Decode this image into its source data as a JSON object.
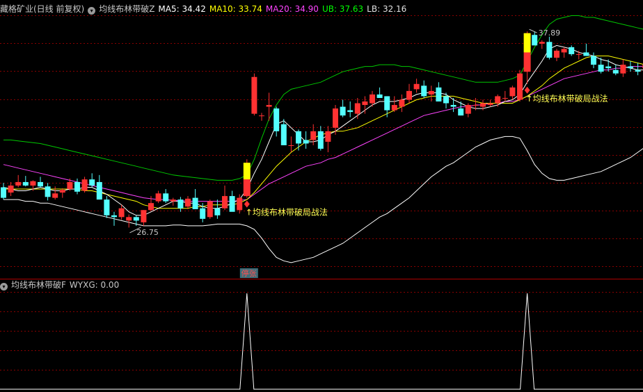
{
  "header": {
    "title": "藏格矿业(日线 前复权)",
    "indicator_name": "均线布林带破Z",
    "ma5": "MA5: 34.42",
    "ma10": "MA10: 33.74",
    "ma20": "MA20: 34.90",
    "ub": "UB: 37.63",
    "lb": "LB: 32.16"
  },
  "sub_header": {
    "indicator_name": "均线布林带破F",
    "value": "WYXG: 0.00"
  },
  "colors": {
    "up": "#ff3232",
    "down": "#54ffff",
    "ma5": "#ffffff",
    "ma10": "#ffff00",
    "ma20": "#ff44ff",
    "ub": "#00c800",
    "lb": "#ffffff",
    "grid": "#8b0000",
    "signal_yellow": "#ffff00",
    "label_yellow": "#ffff54",
    "badge_bg": "#3c6e7a"
  },
  "chart_data": {
    "type": "candlestick",
    "ylim": [
      24.5,
      39.5
    ],
    "annotations": {
      "low_label": "26.75",
      "high_label": "37.89",
      "signal_label": "均线布林带破局战法",
      "badge": "停张"
    },
    "candles": [
      [
        29.6,
        29.85,
        28.9,
        29.0
      ],
      [
        29.3,
        29.9,
        29.1,
        29.7
      ],
      [
        29.7,
        30.3,
        29.6,
        29.9
      ],
      [
        29.9,
        30.25,
        29.65,
        29.7
      ],
      [
        29.7,
        30.0,
        29.4,
        29.95
      ],
      [
        29.9,
        30.2,
        29.6,
        29.65
      ],
      [
        29.65,
        29.85,
        28.85,
        29.05
      ],
      [
        29.0,
        29.65,
        28.9,
        29.25
      ],
      [
        29.3,
        29.55,
        29.0,
        29.45
      ],
      [
        29.5,
        30.1,
        29.4,
        29.9
      ],
      [
        29.9,
        30.1,
        29.2,
        29.35
      ],
      [
        29.4,
        30.2,
        29.3,
        30.05
      ],
      [
        30.05,
        30.4,
        29.6,
        29.7
      ],
      [
        29.9,
        30.3,
        29.0,
        28.9
      ],
      [
        28.9,
        29.1,
        27.85,
        28.0
      ],
      [
        28.0,
        28.2,
        27.4,
        27.9
      ],
      [
        27.9,
        28.6,
        27.75,
        28.4
      ],
      [
        27.7,
        28.05,
        27.3,
        27.9
      ],
      [
        27.9,
        28.0,
        27.4,
        27.7
      ],
      [
        27.6,
        28.3,
        27.4,
        28.3
      ],
      [
        28.3,
        29.1,
        28.25,
        28.7
      ],
      [
        28.8,
        29.4,
        28.7,
        29.25
      ],
      [
        29.25,
        29.5,
        28.7,
        28.8
      ],
      [
        28.8,
        29.0,
        28.55,
        28.9
      ],
      [
        28.9,
        29.05,
        28.2,
        28.4
      ],
      [
        28.5,
        29.1,
        28.35,
        28.95
      ],
      [
        29.0,
        29.5,
        28.9,
        28.35
      ],
      [
        28.4,
        28.7,
        27.6,
        27.8
      ],
      [
        27.9,
        28.9,
        27.8,
        28.8
      ],
      [
        28.4,
        28.9,
        27.8,
        28.0
      ],
      [
        28.4,
        29.7,
        28.3,
        29.1
      ],
      [
        29.1,
        29.4,
        28.4,
        28.2
      ],
      [
        28.3,
        29.2,
        28.1,
        29.0
      ],
      [
        29.1,
        31.2,
        29.0,
        31.0
      ],
      [
        33.8,
        36.1,
        33.7,
        35.9
      ],
      [
        33.7,
        33.85,
        33.4,
        33.7
      ],
      [
        34.2,
        35.0,
        33.4,
        34.3
      ],
      [
        34.1,
        34.2,
        32.5,
        32.8
      ],
      [
        33.2,
        33.5,
        32.0,
        32.0
      ],
      [
        32.0,
        32.5,
        31.6,
        32.0
      ],
      [
        32.8,
        32.9,
        31.7,
        32.1
      ],
      [
        32.3,
        32.8,
        31.8,
        32.1
      ],
      [
        32.3,
        33.2,
        32.0,
        32.8
      ],
      [
        32.8,
        33.1,
        31.7,
        31.8
      ],
      [
        32.2,
        33.1,
        31.6,
        32.8
      ],
      [
        33.0,
        34.3,
        32.6,
        34.1
      ],
      [
        34.2,
        34.6,
        33.6,
        33.7
      ],
      [
        34.0,
        34.5,
        33.6,
        33.9
      ],
      [
        33.8,
        34.7,
        33.5,
        34.4
      ],
      [
        34.3,
        34.8,
        33.8,
        34.5
      ],
      [
        34.4,
        35.1,
        34.2,
        34.9
      ],
      [
        34.9,
        35.3,
        34.7,
        34.7
      ],
      [
        34.8,
        34.8,
        33.6,
        34.0
      ],
      [
        34.0,
        34.8,
        33.9,
        34.3
      ],
      [
        34.2,
        34.9,
        33.9,
        34.6
      ],
      [
        34.6,
        35.5,
        34.4,
        35.1
      ],
      [
        35.2,
        35.8,
        35.0,
        35.5
      ],
      [
        35.4,
        35.7,
        34.7,
        34.8
      ],
      [
        34.9,
        35.4,
        34.5,
        35.1
      ],
      [
        35.3,
        35.6,
        34.5,
        34.5
      ],
      [
        34.8,
        35.0,
        34.1,
        34.4
      ],
      [
        34.3,
        34.7,
        33.9,
        34.2
      ],
      [
        34.1,
        34.5,
        33.7,
        33.7
      ],
      [
        33.8,
        34.4,
        33.6,
        34.3
      ],
      [
        34.3,
        34.7,
        34.0,
        34.3
      ],
      [
        34.2,
        34.6,
        34.0,
        34.4
      ],
      [
        34.3,
        34.6,
        34.2,
        34.4
      ],
      [
        34.4,
        34.9,
        34.2,
        34.8
      ],
      [
        34.7,
        35.1,
        34.5,
        34.7
      ],
      [
        34.8,
        35.4,
        34.6,
        35.3
      ],
      [
        34.6,
        36.3,
        34.5,
        36.1
      ],
      [
        36.2,
        38.5,
        35.5,
        38.4
      ],
      [
        38.3,
        38.5,
        37.7,
        37.7
      ],
      [
        37.8,
        38.0,
        37.5,
        37.9
      ],
      [
        37.9,
        38.2,
        36.9,
        37.0
      ],
      [
        37.0,
        37.5,
        36.8,
        37.4
      ],
      [
        37.3,
        37.6,
        37.0,
        37.5
      ],
      [
        37.6,
        37.7,
        37.1,
        37.2
      ],
      [
        37.2,
        37.4,
        36.9,
        37.2
      ],
      [
        37.3,
        37.8,
        37.1,
        37.1
      ],
      [
        37.1,
        37.3,
        36.4,
        36.6
      ],
      [
        36.6,
        37.0,
        36.1,
        36.2
      ],
      [
        36.5,
        36.9,
        36.2,
        36.4
      ],
      [
        36.3,
        36.6,
        36.0,
        36.1
      ],
      [
        36.1,
        36.9,
        35.9,
        36.6
      ],
      [
        36.5,
        36.8,
        36.2,
        36.4
      ],
      [
        36.3,
        36.7,
        36.0,
        36.2
      ],
      [
        36.4,
        36.8,
        36.2,
        36.6
      ],
      [
        36.6,
        37.5,
        36.2,
        37.2
      ],
      [
        37.2,
        38.2,
        36.7,
        36.7
      ],
      [
        36.8,
        37.4,
        36.5,
        37.3
      ]
    ],
    "ma5": [
      29.6,
      29.5,
      29.4,
      29.4,
      29.5,
      29.6,
      29.5,
      29.4,
      29.4,
      29.5,
      29.5,
      29.6,
      29.6,
      29.4,
      29.2,
      28.9,
      28.6,
      28.2,
      28.0,
      28.0,
      28.2,
      28.4,
      28.6,
      28.8,
      28.8,
      28.7,
      28.7,
      28.5,
      28.4,
      28.4,
      28.5,
      28.7,
      28.9,
      29.5,
      30.4,
      31.2,
      32.2,
      33.2,
      33.4,
      33.0,
      32.6,
      32.2,
      32.2,
      32.3,
      32.6,
      32.8,
      33.1,
      33.4,
      33.7,
      34.0,
      34.3,
      34.5,
      34.5,
      34.5,
      34.6,
      34.7,
      34.9,
      35.0,
      35.0,
      35.0,
      34.9,
      34.6,
      34.4,
      34.2,
      34.1,
      34.1,
      34.2,
      34.3,
      34.5,
      34.6,
      34.9,
      35.6,
      36.2,
      36.8,
      37.5,
      37.7,
      37.6,
      37.5,
      37.3,
      37.2,
      37.1,
      36.9,
      36.8,
      36.6,
      36.5,
      36.4,
      36.3,
      36.3,
      36.4,
      36.6,
      36.7
    ],
    "ma10": [
      29.5,
      29.5,
      29.5,
      29.5,
      29.5,
      29.5,
      29.5,
      29.5,
      29.5,
      29.5,
      29.5,
      29.4,
      29.4,
      29.3,
      29.2,
      29.1,
      29.0,
      28.9,
      28.8,
      28.6,
      28.5,
      28.4,
      28.4,
      28.4,
      28.4,
      28.4,
      28.5,
      28.5,
      28.6,
      28.6,
      28.6,
      28.6,
      28.7,
      28.9,
      29.3,
      29.8,
      30.3,
      30.8,
      31.2,
      31.6,
      31.9,
      32.2,
      32.4,
      32.6,
      32.7,
      32.8,
      32.8,
      32.9,
      33.0,
      33.2,
      33.4,
      33.6,
      33.8,
      34.0,
      34.2,
      34.4,
      34.6,
      34.7,
      34.8,
      34.8,
      34.8,
      34.8,
      34.7,
      34.6,
      34.5,
      34.4,
      34.4,
      34.4,
      34.4,
      34.4,
      34.6,
      34.8,
      35.1,
      35.4,
      35.8,
      36.1,
      36.4,
      36.6,
      36.8,
      37.0,
      37.1,
      37.1,
      37.1,
      37.0,
      36.9,
      36.8,
      36.7,
      36.6,
      36.6,
      36.6,
      36.6
    ],
    "ma20": [
      30.9,
      30.8,
      30.7,
      30.6,
      30.5,
      30.4,
      30.3,
      30.2,
      30.1,
      30.0,
      29.9,
      29.8,
      29.7,
      29.6,
      29.5,
      29.4,
      29.3,
      29.2,
      29.1,
      29.0,
      28.95,
      28.9,
      28.9,
      28.85,
      28.85,
      28.8,
      28.8,
      28.8,
      28.8,
      28.8,
      28.8,
      28.8,
      28.85,
      28.9,
      29.2,
      29.5,
      29.8,
      30.0,
      30.2,
      30.4,
      30.6,
      30.8,
      30.9,
      31.0,
      31.2,
      31.3,
      31.5,
      31.7,
      31.9,
      32.1,
      32.3,
      32.5,
      32.7,
      32.9,
      33.1,
      33.3,
      33.5,
      33.7,
      33.8,
      33.9,
      34.0,
      34.1,
      34.2,
      34.2,
      34.3,
      34.3,
      34.4,
      34.4,
      34.5,
      34.5,
      34.6,
      34.8,
      35.0,
      35.2,
      35.4,
      35.6,
      35.8,
      35.9,
      36.0,
      36.1,
      36.2,
      36.3,
      36.3,
      36.4,
      36.4,
      36.5,
      36.5,
      36.5,
      36.6,
      36.6,
      36.7
    ],
    "ub": [
      32.3,
      32.3,
      32.25,
      32.2,
      32.15,
      32.1,
      32.0,
      31.9,
      31.8,
      31.7,
      31.6,
      31.5,
      31.4,
      31.3,
      31.2,
      31.1,
      31.0,
      30.9,
      30.8,
      30.7,
      30.6,
      30.5,
      30.4,
      30.3,
      30.25,
      30.2,
      30.15,
      30.1,
      30.05,
      30.0,
      30.0,
      30.0,
      30.1,
      30.3,
      31.2,
      32.4,
      33.5,
      34.3,
      34.9,
      35.2,
      35.3,
      35.4,
      35.5,
      35.6,
      35.8,
      36.0,
      36.2,
      36.3,
      36.4,
      36.5,
      36.5,
      36.6,
      36.6,
      36.6,
      36.5,
      36.5,
      36.4,
      36.3,
      36.2,
      36.1,
      36.0,
      35.9,
      35.8,
      35.7,
      35.6,
      35.6,
      35.6,
      35.6,
      35.7,
      35.8,
      36.0,
      36.8,
      37.6,
      38.3,
      38.9,
      39.2,
      39.3,
      39.4,
      39.4,
      39.3,
      39.3,
      39.2,
      39.1,
      39.0,
      38.9,
      38.8,
      38.7,
      38.6,
      38.5,
      38.4,
      38.3
    ],
    "lb": [
      28.9,
      28.9,
      28.9,
      28.8,
      28.8,
      28.7,
      28.7,
      28.6,
      28.5,
      28.4,
      28.3,
      28.2,
      28.1,
      28.0,
      27.9,
      27.8,
      27.7,
      27.6,
      27.5,
      27.4,
      27.4,
      27.4,
      27.4,
      27.45,
      27.45,
      27.4,
      27.4,
      27.4,
      27.45,
      27.5,
      27.5,
      27.5,
      27.5,
      27.4,
      27.2,
      26.7,
      26.1,
      25.6,
      25.4,
      25.3,
      25.4,
      25.5,
      25.6,
      25.8,
      26.0,
      26.2,
      26.4,
      26.7,
      27.0,
      27.3,
      27.6,
      27.9,
      28.1,
      28.4,
      28.7,
      29.0,
      29.4,
      29.8,
      30.2,
      30.5,
      30.8,
      31.0,
      31.3,
      31.6,
      31.9,
      32.1,
      32.3,
      32.4,
      32.5,
      32.5,
      32.4,
      31.7,
      30.9,
      30.4,
      30.1,
      30.0,
      30.0,
      30.1,
      30.2,
      30.3,
      30.4,
      30.5,
      30.7,
      30.9,
      31.1,
      31.3,
      31.6,
      31.9,
      32.2,
      32.5,
      32.7
    ],
    "signal_bars": [
      33,
      71
    ],
    "wyxg_ylim": [
      0,
      1
    ]
  }
}
